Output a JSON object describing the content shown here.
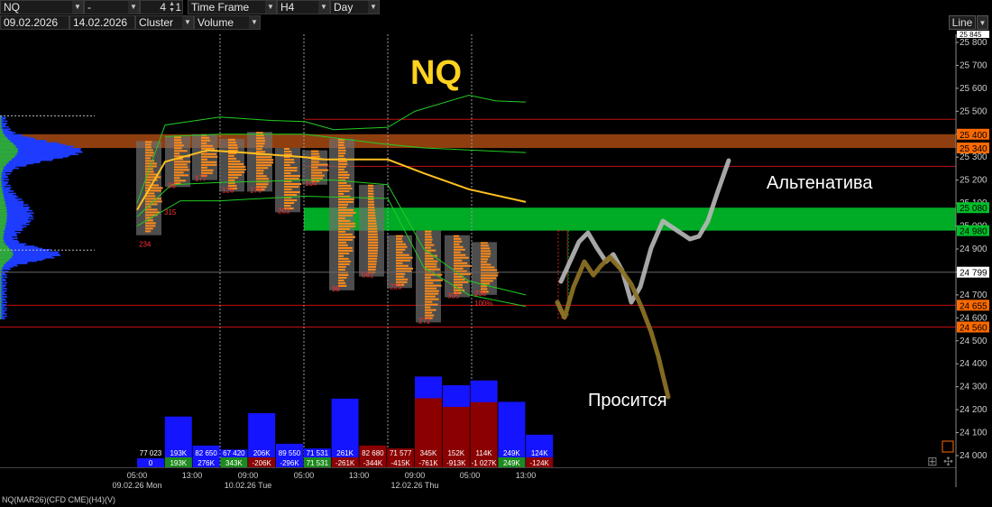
{
  "toolbar": {
    "symbol": "NQ",
    "connector": "-",
    "count": "4",
    "count_suffix": "1",
    "tf_label": "Time Frame",
    "tf_value": "H4",
    "period": "Day",
    "date_from": "09.02.2026",
    "date_to": "14.02.2026",
    "chart_type": "Cluster",
    "mode": "Volume",
    "line_button": "Line",
    "colors": {
      "bg": "#000000",
      "accent_orange": "#ff6a00",
      "zone_green": "#00c02a",
      "zone_orange": "#a84a12",
      "cluster_orange": "#ff8c1a",
      "vwap_yellow": "#ffc020",
      "band_green": "#22cc22"
    }
  },
  "footer": {
    "instrument": "NQ(MAR26)(CFD CME)(H4)(V)"
  },
  "annotations": {
    "title": "NQ",
    "alt": "Альтенатива",
    "asks": "Просится"
  },
  "chart_data": {
    "type": "cluster",
    "ylim": [
      23900,
      25845
    ],
    "y_ticks": [
      25800,
      25700,
      25600,
      25500,
      25400,
      25300,
      25200,
      25100,
      25000,
      24900,
      24800,
      24700,
      24600,
      24500,
      24400,
      24300,
      24200,
      24100,
      24000
    ],
    "y_tick_labels": [
      "25 800",
      "25 700",
      "25 600",
      "25 500",
      "25 400",
      "25 300",
      "25 200",
      "25 100",
      "25 000",
      "24 900",
      "24 800",
      "24 700",
      "24 600",
      "24 500",
      "24 400",
      "24 300",
      "24 200",
      "24 100",
      "24 000"
    ],
    "top_label": "25 845",
    "price_tags": [
      {
        "label": "25 400",
        "value": 25400,
        "color": "#ff6a00"
      },
      {
        "label": "25 340",
        "value": 25340,
        "color": "#ff6a00"
      },
      {
        "label": "25 080",
        "value": 25080,
        "color": "#00c02a"
      },
      {
        "label": "24 980",
        "value": 24980,
        "color": "#00c02a"
      },
      {
        "label": "24 799",
        "value": 24799,
        "color": "#ffffff"
      },
      {
        "label": "24 655",
        "value": 24655,
        "color": "#ff6a00"
      },
      {
        "label": "24 560",
        "value": 24560,
        "color": "#ff6a00"
      }
    ],
    "zones": [
      {
        "from": 25340,
        "to": 25400,
        "color": "#a84a12"
      },
      {
        "from": 24980,
        "to": 25080,
        "color": "#00b428"
      }
    ],
    "hlines": [
      {
        "value": 25465,
        "color": "#c01010"
      },
      {
        "value": 25260,
        "color": "#c01010"
      },
      {
        "value": 24655,
        "color": "#c01010"
      },
      {
        "value": 24560,
        "color": "#c01010"
      }
    ],
    "x_labels": [
      {
        "time": "05:00",
        "date": "09.02.26 Mon"
      },
      {
        "time": "13:00",
        "date": ""
      },
      {
        "time": "09:00",
        "date": "10.02.26 Tue"
      },
      {
        "time": "05:00",
        "date": ""
      },
      {
        "time": "13:00",
        "date": ""
      },
      {
        "time": "09:00",
        "date": "12.02.26 Thu"
      },
      {
        "time": "05:00",
        "date": ""
      },
      {
        "time": "13:00",
        "date": ""
      }
    ],
    "candles": [
      {
        "high": 25370,
        "low": 24960,
        "poc_label": "234",
        "poc_low": 24950,
        "mark": "315"
      },
      {
        "high": 25390,
        "low": 25170,
        "poc_label": "98"
      },
      {
        "high": 25400,
        "low": 25200,
        "poc_label": "177"
      },
      {
        "high": 25380,
        "low": 25150,
        "poc_label": "126"
      },
      {
        "high": 25410,
        "low": 25150,
        "poc_label": "176"
      },
      {
        "high": 25340,
        "low": 25060,
        "poc_label": "203"
      },
      {
        "high": 25330,
        "low": 25180,
        "poc_label": "104"
      },
      {
        "high": 25380,
        "low": 24720,
        "poc_label": "98"
      },
      {
        "high": 25180,
        "low": 24780,
        "poc_label": "561"
      },
      {
        "high": 24960,
        "low": 24730,
        "poc_label": "223"
      },
      {
        "high": 24980,
        "low": 24580,
        "poc_label": "272"
      },
      {
        "high": 24960,
        "low": 24690,
        "poc_label": "305"
      },
      {
        "high": 24930,
        "low": 24700,
        "poc_label": "238",
        "extra": "100%"
      }
    ],
    "vwap": [
      25070,
      25200,
      25250,
      25280,
      25300,
      25290,
      25280,
      25280,
      25230,
      25180,
      25150,
      25120,
      25100
    ],
    "volume": {
      "max": 343000,
      "bars": [
        {
          "total": "77 023",
          "delta": "0",
          "value": 0,
          "dominant": "blue"
        },
        {
          "total": "193K",
          "delta": "193K",
          "value": 193000,
          "dominant": "blue",
          "bg": "green"
        },
        {
          "total": "82 650",
          "delta": "276K",
          "value": 82650,
          "dominant": "blue"
        },
        {
          "total": "67 420",
          "delta": "343K",
          "value": 67420,
          "dominant": "blue",
          "bg": "green"
        },
        {
          "total": "206K",
          "delta": "-206K",
          "value": 206000,
          "dominant": "blue",
          "bg": "red"
        },
        {
          "total": "89 550",
          "delta": "-296K",
          "value": 89550,
          "dominant": "blue"
        },
        {
          "total": "71 531",
          "delta": "71 531",
          "value": 71531,
          "dominant": "blue",
          "bg": "green"
        },
        {
          "total": "261K",
          "delta": "-261K",
          "value": 261000,
          "dominant": "blue",
          "bg": "red"
        },
        {
          "total": "82 680",
          "delta": "-344K",
          "value": 82680,
          "dominant": "red"
        },
        {
          "total": "71 577",
          "delta": "-415K",
          "value": 71577,
          "dominant": "red"
        },
        {
          "total": "345K",
          "delta": "-761K",
          "value": 345000,
          "dominant": "red",
          "bg": "red"
        },
        {
          "total": "152K",
          "delta": "-913K",
          "value": 312000,
          "dominant": "red"
        },
        {
          "total": "114K",
          "delta": "-1 027K",
          "value": 330000,
          "dominant": "red"
        },
        {
          "total": "249K",
          "delta": "249K",
          "value": 249000,
          "dominant": "blue",
          "bg": "green"
        },
        {
          "total": "124K",
          "delta": "-124K",
          "value": 124000,
          "dominant": "blue",
          "bg": "red"
        }
      ]
    }
  }
}
